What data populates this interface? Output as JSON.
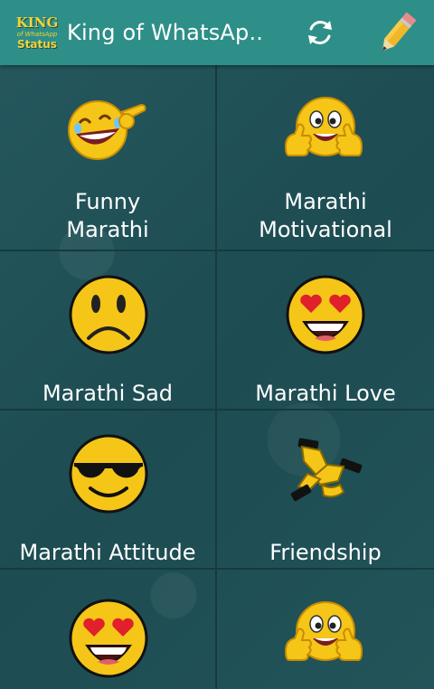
{
  "app": {
    "logo_line1": "KING",
    "logo_line2": "of WhatsApp",
    "logo_line3": "Status",
    "title": "King of WhatsAp..",
    "accent_color": "#2e8f88",
    "background_color": "#1f4f55"
  },
  "toolbar": {
    "refresh_icon": "refresh-icon",
    "edit_icon": "pencil-icon"
  },
  "categories": [
    {
      "label": "Funny\nMarathi",
      "line1": "Funny",
      "line2": "Marathi",
      "icon": "laughing-emoji-icon"
    },
    {
      "label": "Marathi\nMotivational",
      "line1": "Marathi",
      "line2": "Motivational",
      "icon": "thumbs-up-emoji-icon"
    },
    {
      "label": "Marathi Sad",
      "icon": "sad-emoji-icon"
    },
    {
      "label": "Marathi Love",
      "icon": "heart-eyes-emoji-icon"
    },
    {
      "label": "Marathi Attitude",
      "icon": "sunglasses-emoji-icon"
    },
    {
      "label": "Friendship",
      "icon": "handshake-icon"
    },
    {
      "label": "",
      "icon": "heart-eyes-emoji-icon"
    },
    {
      "label": "",
      "icon": "thumbs-up-emoji-icon"
    }
  ]
}
